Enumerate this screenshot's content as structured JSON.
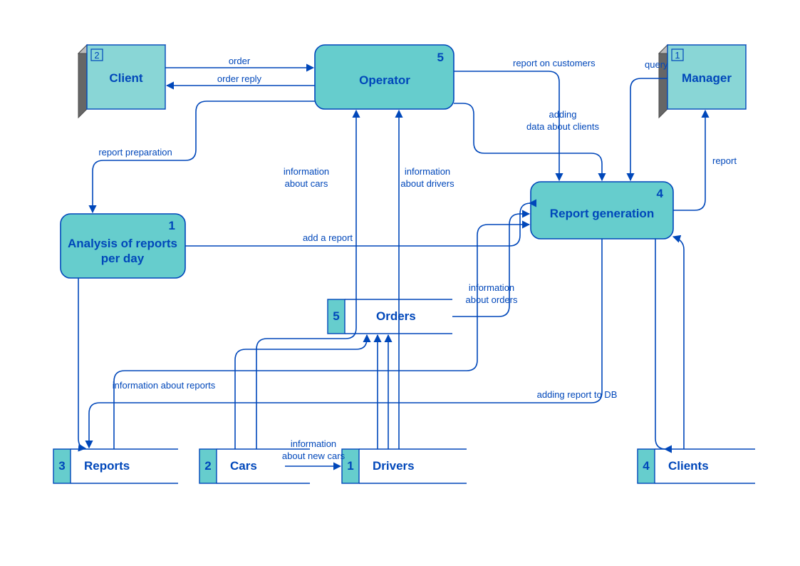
{
  "external": {
    "client": {
      "num": "2",
      "label": "Client"
    },
    "manager": {
      "num": "1",
      "label": "Manager"
    }
  },
  "process": {
    "operator": {
      "num": "5",
      "label": "Operator"
    },
    "analysis": {
      "num": "1",
      "label1": "Analysis of reports",
      "label2": "per day"
    },
    "reportgen": {
      "num": "4",
      "label": "Report generation"
    }
  },
  "datastore": {
    "orders": {
      "num": "5",
      "label": "Orders"
    },
    "reports": {
      "num": "3",
      "label": "Reports"
    },
    "cars": {
      "num": "2",
      "label": "Cars"
    },
    "drivers": {
      "num": "1",
      "label": "Drivers"
    },
    "clients": {
      "num": "4",
      "label": "Clients"
    }
  },
  "flows": {
    "f1": "order",
    "f2": "order reply",
    "f3": "report preparation",
    "f4a": "information",
    "f4b": "about cars",
    "f5a": "information",
    "f5b": "about drivers",
    "f6": "report on customers",
    "f7a": "adding",
    "f7b": "data about clients",
    "f8": "query",
    "f9": "report",
    "f10": "add a report",
    "f11a": "information",
    "f11b": "about orders",
    "f12": "information about reports",
    "f13": "adding report to DB",
    "f14a": "information",
    "f14b": "about new cars"
  }
}
